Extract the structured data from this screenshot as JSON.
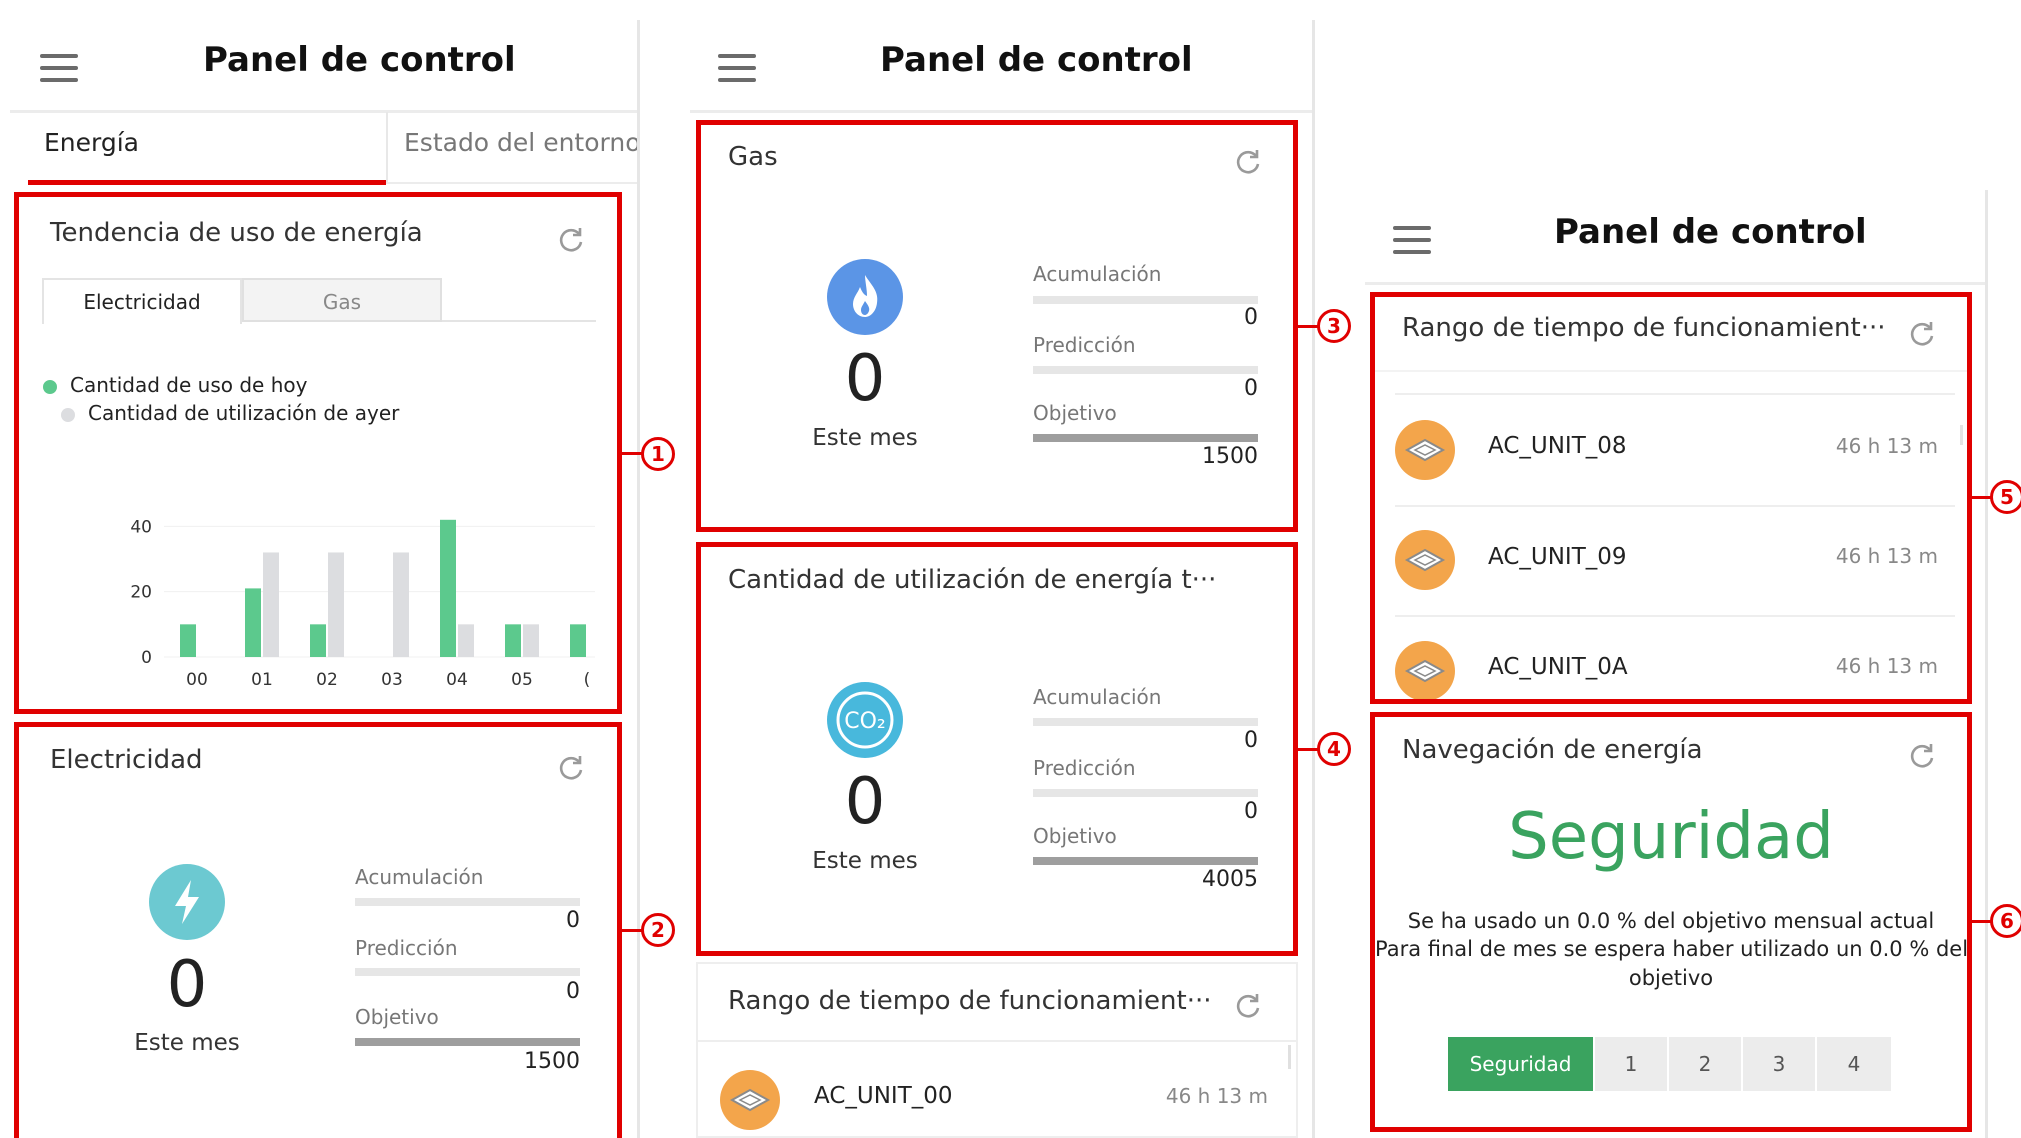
{
  "screens": [
    {
      "title": "Panel de control"
    },
    {
      "title": "Panel de control"
    },
    {
      "title": "Panel de control"
    }
  ],
  "tabs": {
    "energy": "Energía",
    "environment": "Estado del entorno"
  },
  "trend_card": {
    "title": "Tendencia de uso de energía",
    "subtabs": [
      "Electricidad",
      "Gas"
    ],
    "legend": [
      "Cantidad de uso de hoy",
      "Cantidad de utilización de ayer"
    ]
  },
  "chart_data": {
    "type": "bar",
    "categories": [
      "00",
      "01",
      "02",
      "03",
      "04",
      "05",
      "("
    ],
    "series": [
      {
        "name": "Cantidad de uso de hoy",
        "values": [
          10,
          21,
          10,
          0,
          42,
          10,
          10
        ]
      },
      {
        "name": "Cantidad de utilización de ayer",
        "values": [
          0,
          32,
          32,
          32,
          10,
          10,
          0
        ]
      }
    ],
    "yticks": [
      "0",
      "20",
      "40"
    ],
    "ylim": [
      0,
      45
    ],
    "colors": {
      "today": "#5cc98d",
      "yesterday": "#dcdde0"
    }
  },
  "electricity_card": {
    "title": "Electricidad",
    "value": "0",
    "period": "Este mes",
    "acc_label": "Acumulación",
    "acc_value": "0",
    "pred_label": "Predicción",
    "pred_value": "0",
    "target_label": "Objetivo",
    "target_value": "1500",
    "icon": "lightning-icon",
    "icon_color": "#6cc9d1"
  },
  "gas_card": {
    "title": "Gas",
    "value": "0",
    "period": "Este mes",
    "acc_label": "Acumulación",
    "acc_value": "0",
    "pred_label": "Predicción",
    "pred_value": "0",
    "target_label": "Objetivo",
    "target_value": "1500",
    "icon": "flame-icon",
    "icon_color": "#5b95e6"
  },
  "co2_card": {
    "title": "Cantidad de utilización de energía t···",
    "value": "0",
    "period": "Este mes",
    "acc_label": "Acumulación",
    "acc_value": "0",
    "pred_label": "Predicción",
    "pred_value": "0",
    "target_label": "Objetivo",
    "target_value": "4005",
    "icon": "co2-icon",
    "icon_text": "CO₂",
    "icon_color": "#48b8dc"
  },
  "runtime_card_mid": {
    "title": "Rango de tiempo de funcionamient···",
    "units": [
      {
        "name": "AC_UNIT_00",
        "time": "46 h 13 m"
      }
    ]
  },
  "runtime_card_right": {
    "title": "Rango de tiempo de funcionamient···",
    "units": [
      {
        "name": "AC_UNIT_08",
        "time": "46 h 13 m"
      },
      {
        "name": "AC_UNIT_09",
        "time": "46 h 13 m"
      },
      {
        "name": "AC_UNIT_0A",
        "time": "46 h 13 m"
      }
    ]
  },
  "energy_nav": {
    "title": "Navegación de energía",
    "status": "Seguridad",
    "status_color": "#3aa35f",
    "line1": "Se ha usado un 0.0 % del objetivo mensual actual",
    "line2": "Para final de mes se espera haber utilizado un 0.0 % del",
    "line3": "objetivo",
    "levels": [
      "Seguridad",
      "1",
      "2",
      "3",
      "4"
    ]
  },
  "callouts": [
    "1",
    "2",
    "3",
    "4",
    "5",
    "6"
  ]
}
